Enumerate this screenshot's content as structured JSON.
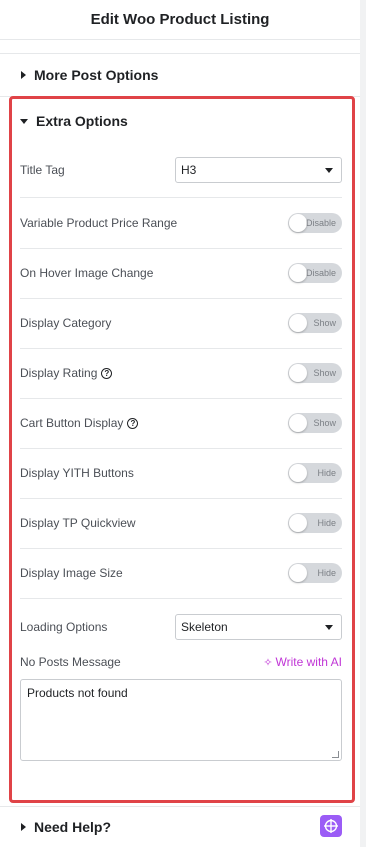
{
  "header": {
    "title": "Edit Woo Product Listing"
  },
  "sections": {
    "more_post_options": "More Post Options",
    "extra_options": "Extra Options",
    "need_help": "Need Help?"
  },
  "fields": {
    "title_tag": {
      "label": "Title Tag",
      "value": "H3"
    },
    "variable_price_range": {
      "label": "Variable Product Price Range",
      "state": "Disable"
    },
    "hover_image_change": {
      "label": "On Hover Image Change",
      "state": "Disable"
    },
    "display_category": {
      "label": "Display Category",
      "state": "Show"
    },
    "display_rating": {
      "label": "Display Rating",
      "state": "Show"
    },
    "cart_button_display": {
      "label": "Cart Button Display",
      "state": "Show"
    },
    "display_yith_buttons": {
      "label": "Display YITH Buttons",
      "state": "Hide"
    },
    "display_tp_quickview": {
      "label": "Display TP Quickview",
      "state": "Hide"
    },
    "display_image_size": {
      "label": "Display Image Size",
      "state": "Hide"
    },
    "loading_options": {
      "label": "Loading Options",
      "value": "Skeleton"
    },
    "no_posts_message": {
      "label": "No Posts Message",
      "ai_link": "Write with AI",
      "value": "Products not found"
    }
  },
  "colors": {
    "highlight_border": "#e04347",
    "ai_accent": "#c036d6",
    "help_icon_bg": "#9b5cf6"
  },
  "icons": {
    "help": "question-circle-icon",
    "ai": "sparkle-icon",
    "need_help": "plus-cross-icon"
  }
}
